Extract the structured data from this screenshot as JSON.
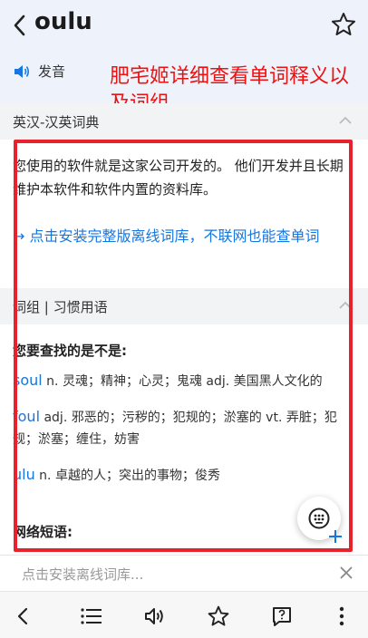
{
  "header": {
    "word": "oulu"
  },
  "pronunciation": {
    "label": "发音"
  },
  "annotation": {
    "text": "肥宅姬详细查看单词释义以及词组"
  },
  "dictionary": {
    "title": "英汉-汉英词典",
    "body": "您使用的软件就是这家公司开发的。 他们开发并且长期维护本软件和软件内置的资料库。",
    "install_link": "→ 点击安装完整版离线词库，不联网也能查单词"
  },
  "phrases": {
    "title": "词组 | 习惯用语",
    "suggest_title": "您要查找的是不是:",
    "entries": [
      {
        "word": "soul",
        "def": " n. 灵魂；精神；心灵；鬼魂 adj. 美国黑人文化的"
      },
      {
        "word": "foul",
        "def": " adj. 邪恶的；污秽的；犯规的；淤塞的 vt. 弄脏；犯规；淤塞；缠住，妨害"
      },
      {
        "word": "ulu",
        "def": " n. 卓越的人；突出的事物；俊秀"
      }
    ],
    "net_title": "网络短语:"
  },
  "install_bar": {
    "placeholder": "点击安装离线词库..."
  }
}
